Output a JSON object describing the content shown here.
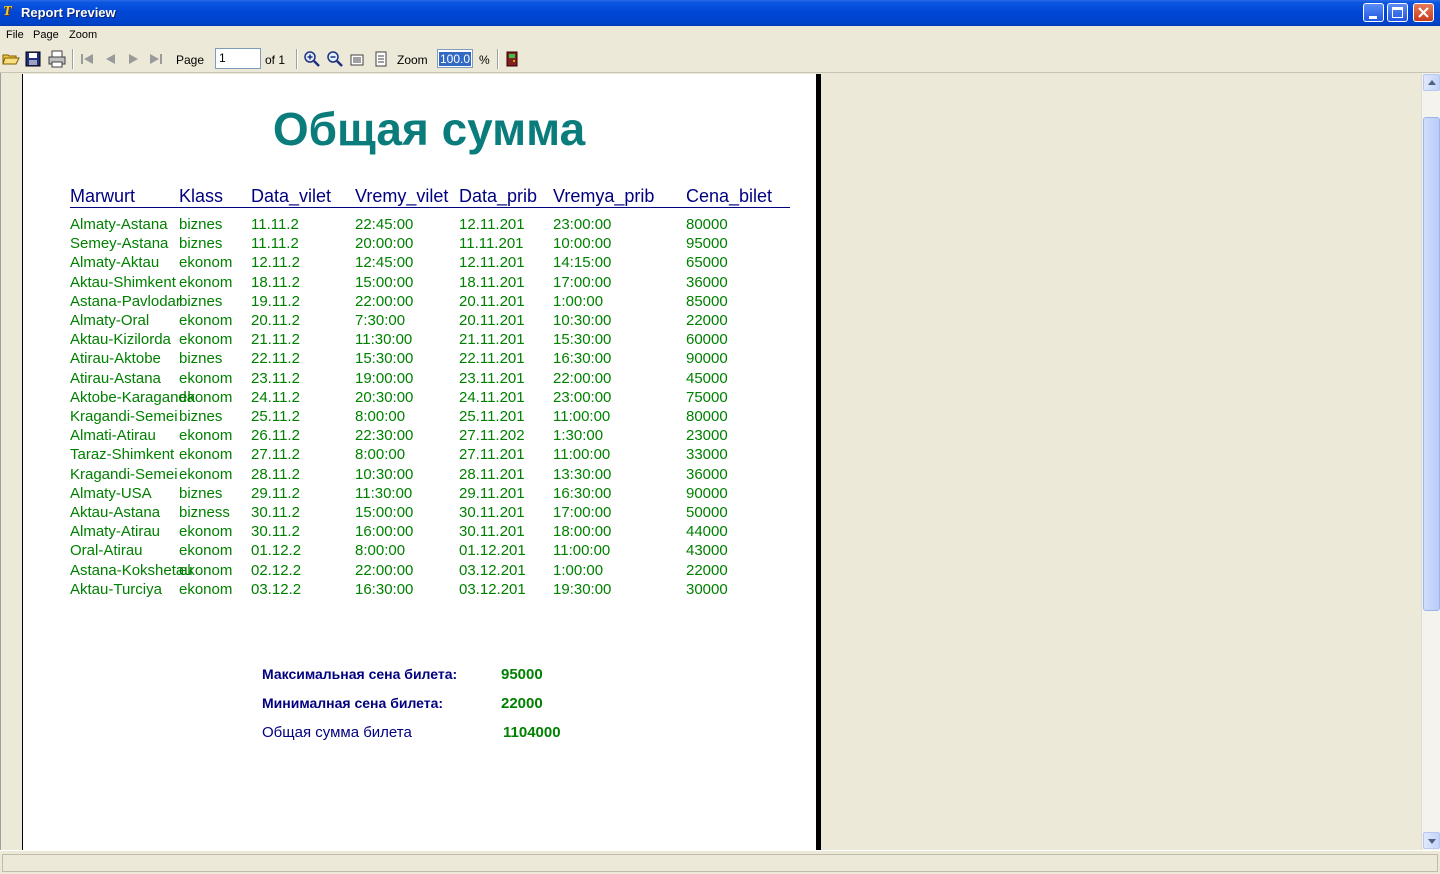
{
  "window": {
    "title": "Report Preview"
  },
  "menu": [
    {
      "label": "File"
    },
    {
      "label": "Page"
    },
    {
      "label": "Zoom"
    }
  ],
  "toolbar": {
    "page_label": "Page",
    "page_value": "1",
    "of_label": "of 1",
    "zoom_label": "Zoom",
    "zoom_value": "100.0",
    "percent_label": "%",
    "icons": [
      "open-icon",
      "save-icon",
      "print-icon",
      "first-page-icon",
      "prev-page-icon",
      "next-page-icon",
      "last-page-icon",
      "zoom-in-icon",
      "zoom-out-icon",
      "page-width-icon",
      "whole-page-icon",
      "close-report-icon"
    ]
  },
  "report": {
    "title": "Общая сумма",
    "columns": [
      "Marwurt",
      "Klass",
      "Data_vilet",
      "Vremy_vilet",
      "Data_prib",
      "Vremya_prib",
      "Cena_bilet"
    ],
    "rows": [
      [
        "Almaty-Astana",
        "biznes",
        "11.11.2",
        "22:45:00",
        "12.11.201",
        "23:00:00",
        "80000"
      ],
      [
        "Semey-Astana",
        "biznes",
        "11.11.2",
        "20:00:00",
        "11.11.201",
        "10:00:00",
        "95000"
      ],
      [
        "Almaty-Aktau",
        "ekonom",
        "12.11.2",
        "12:45:00",
        "12.11.201",
        "14:15:00",
        "65000"
      ],
      [
        "Aktau-Shimkent",
        "ekonom",
        "18.11.2",
        "15:00:00",
        "18.11.201",
        "17:00:00",
        "36000"
      ],
      [
        "Astana-Pavlodar",
        "biznes",
        "19.11.2",
        "22:00:00",
        "20.11.201",
        "1:00:00",
        "85000"
      ],
      [
        "Almaty-Oral",
        "ekonom",
        "20.11.2",
        "7:30:00",
        "20.11.201",
        "10:30:00",
        "22000"
      ],
      [
        "Aktau-Kizilorda",
        "ekonom",
        "21.11.2",
        "11:30:00",
        "21.11.201",
        "15:30:00",
        "60000"
      ],
      [
        "Atirau-Aktobe",
        "biznes",
        "22.11.2",
        "15:30:00",
        "22.11.201",
        "16:30:00",
        "90000"
      ],
      [
        "Atirau-Astana",
        "ekonom",
        "23.11.2",
        "19:00:00",
        "23.11.201",
        "22:00:00",
        "45000"
      ],
      [
        "Aktobe-Karaganda",
        "ekonom",
        "24.11.2",
        "20:30:00",
        "24.11.201",
        "23:00:00",
        "75000"
      ],
      [
        "Kragandi-Semei",
        "biznes",
        "25.11.2",
        "8:00:00",
        "25.11.201",
        "11:00:00",
        "80000"
      ],
      [
        "Almati-Atirau",
        "ekonom",
        "26.11.2",
        "22:30:00",
        "27.11.202",
        "1:30:00",
        "23000"
      ],
      [
        "Taraz-Shimkent",
        "ekonom",
        "27.11.2",
        "8:00:00",
        "27.11.201",
        "11:00:00",
        "33000"
      ],
      [
        "Kragandi-Semei",
        "ekonom",
        "28.11.2",
        "10:30:00",
        "28.11.201",
        "13:30:00",
        "36000"
      ],
      [
        "Almaty-USA",
        "biznes",
        "29.11.2",
        "11:30:00",
        "29.11.201",
        "16:30:00",
        "90000"
      ],
      [
        "Aktau-Astana",
        "bizness",
        "30.11.2",
        "15:00:00",
        "30.11.201",
        "17:00:00",
        "50000"
      ],
      [
        "Almaty-Atirau",
        "ekonom",
        "30.11.2",
        "16:00:00",
        "30.11.201",
        "18:00:00",
        "44000"
      ],
      [
        "Oral-Atirau",
        "ekonom",
        "01.12.2",
        "8:00:00",
        "01.12.201",
        "11:00:00",
        "43000"
      ],
      [
        "Astana-Kokshetau",
        "ekonom",
        "02.12.2",
        "22:00:00",
        "03.12.201",
        "1:00:00",
        "22000"
      ],
      [
        "Aktau-Turciya",
        "ekonom",
        "03.12.2",
        "16:30:00",
        "03.12.201",
        "19:30:00",
        "30000"
      ]
    ],
    "summary": {
      "max_label": "Максимальная сена билета:",
      "max_value": "95000",
      "min_label": "Минималная сена билета:",
      "min_value": "22000",
      "total_label": "Общая сумма билета",
      "total_value": "1104000"
    }
  },
  "colors": {
    "title": "#0a7c7c",
    "header": "#000080",
    "data": "#008000",
    "titlebar": "#0046d5"
  }
}
